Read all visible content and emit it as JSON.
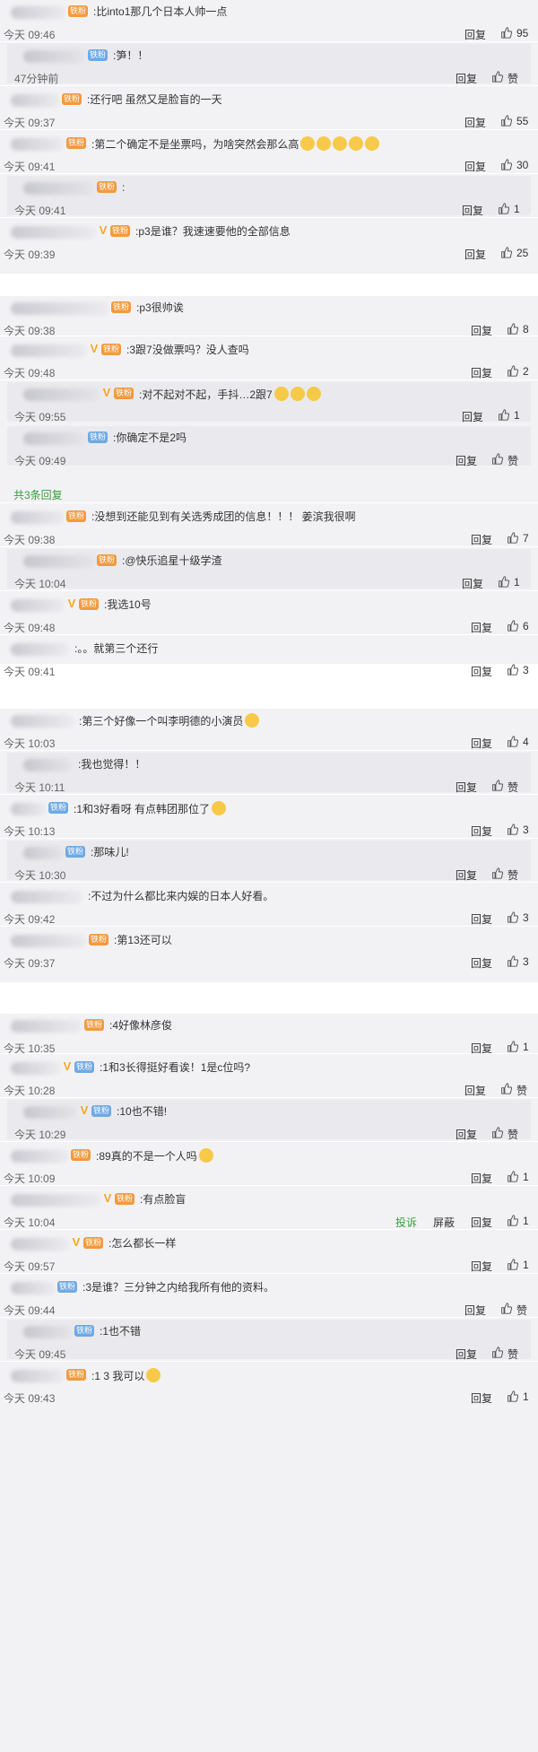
{
  "labels": {
    "reply": "回复",
    "like_word": "赞",
    "report": "投诉",
    "block": "屏蔽",
    "fan_badge": "铁粉",
    "colon": ":",
    "v_mark": "V"
  },
  "sections": [
    {
      "more": "",
      "comments": [
        {
          "text": "比into1那几个日本人帅一点",
          "time": "今天 09:46",
          "likes": "95"
        },
        {
          "text": "笋！！",
          "time": "47分钟前",
          "likes": "赞"
        },
        {
          "text": "还行吧 虽然又是脸盲的一天",
          "time": "今天 09:37",
          "likes": "55"
        },
        {
          "text": "第二个确定不是坐票吗，为啥突然会那么高",
          "time": "今天 09:41",
          "likes": "30"
        },
        {
          "text": "",
          "time": "今天 09:41",
          "likes": "1"
        },
        {
          "text": "p3是谁？我速速要他的全部信息",
          "time": "今天 09:39",
          "likes": "25"
        }
      ]
    },
    {
      "more": "共3条回复",
      "comments": [
        {
          "text": "p3很帅诶",
          "time": "今天 09:38",
          "likes": "8"
        },
        {
          "text": "3跟7没做票吗？没人查吗",
          "time": "今天 09:48",
          "likes": "2"
        },
        {
          "text": "对不起对不起，手抖…2跟7",
          "time": "今天 09:55",
          "likes": "1"
        },
        {
          "text": "你确定不是2吗",
          "time": "今天 09:49",
          "likes": "赞"
        },
        {
          "text": "没想到还能见到有关选秀成团的信息！！！ 姜滨我很啊",
          "time": "今天 09:38",
          "likes": "7"
        },
        {
          "text": "@快乐追星十级学渣",
          "time": "今天 10:04",
          "likes": "1"
        },
        {
          "text": "我选10号",
          "time": "今天 09:48",
          "likes": "6"
        },
        {
          "text": "。。就第三个还行",
          "time": "今天 09:41",
          "likes": "3"
        }
      ]
    },
    {
      "more": "",
      "comments": [
        {
          "text": "第三个好像一个叫李明德的小演员",
          "time": "今天 10:03",
          "likes": "4"
        },
        {
          "text": "我也觉得！！",
          "time": "今天 10:11",
          "likes": "赞"
        },
        {
          "text": "1和3好看呀 有点韩团那位了",
          "time": "今天 10:13",
          "likes": "3"
        },
        {
          "text": "那味儿!",
          "time": "今天 10:30",
          "likes": "赞"
        },
        {
          "text": "不过为什么都比来内娱的日本人好看。",
          "time": "今天 09:42",
          "likes": "3"
        },
        {
          "text": "第13还可以",
          "time": "今天 09:37",
          "likes": "3"
        }
      ]
    },
    {
      "more": "",
      "comments": [
        {
          "text": "4好像林彦俊",
          "time": "今天 10:35",
          "likes": "1"
        },
        {
          "text": "1和3长得挺好看诶！1是c位吗?",
          "time": "今天 10:28",
          "likes": "赞"
        },
        {
          "text": "10也不错!",
          "time": "今天 10:29",
          "likes": "赞"
        },
        {
          "text": "89真的不是一个人吗",
          "time": "今天 10:09",
          "likes": "1"
        },
        {
          "text": "有点脸盲",
          "time": "今天 10:04",
          "likes": "1"
        },
        {
          "text": "怎么都长一样",
          "time": "今天 09:57",
          "likes": "1"
        },
        {
          "text": "3是谁？三分钟之内给我所有他的资料。",
          "time": "今天 09:44",
          "likes": "赞"
        },
        {
          "text": "1也不错",
          "time": "今天 09:45",
          "likes": "赞"
        },
        {
          "text": "1 3 我可以",
          "time": "今天 09:43",
          "likes": "1"
        }
      ]
    }
  ],
  "colors": {
    "bg": "#f2f2f5",
    "reply_bg": "#eaeaee",
    "green": "#3a9d3a",
    "fan_orange": "#f29a3d",
    "fan_blue": "#6ea9e4",
    "v_gold": "#f5a623"
  }
}
